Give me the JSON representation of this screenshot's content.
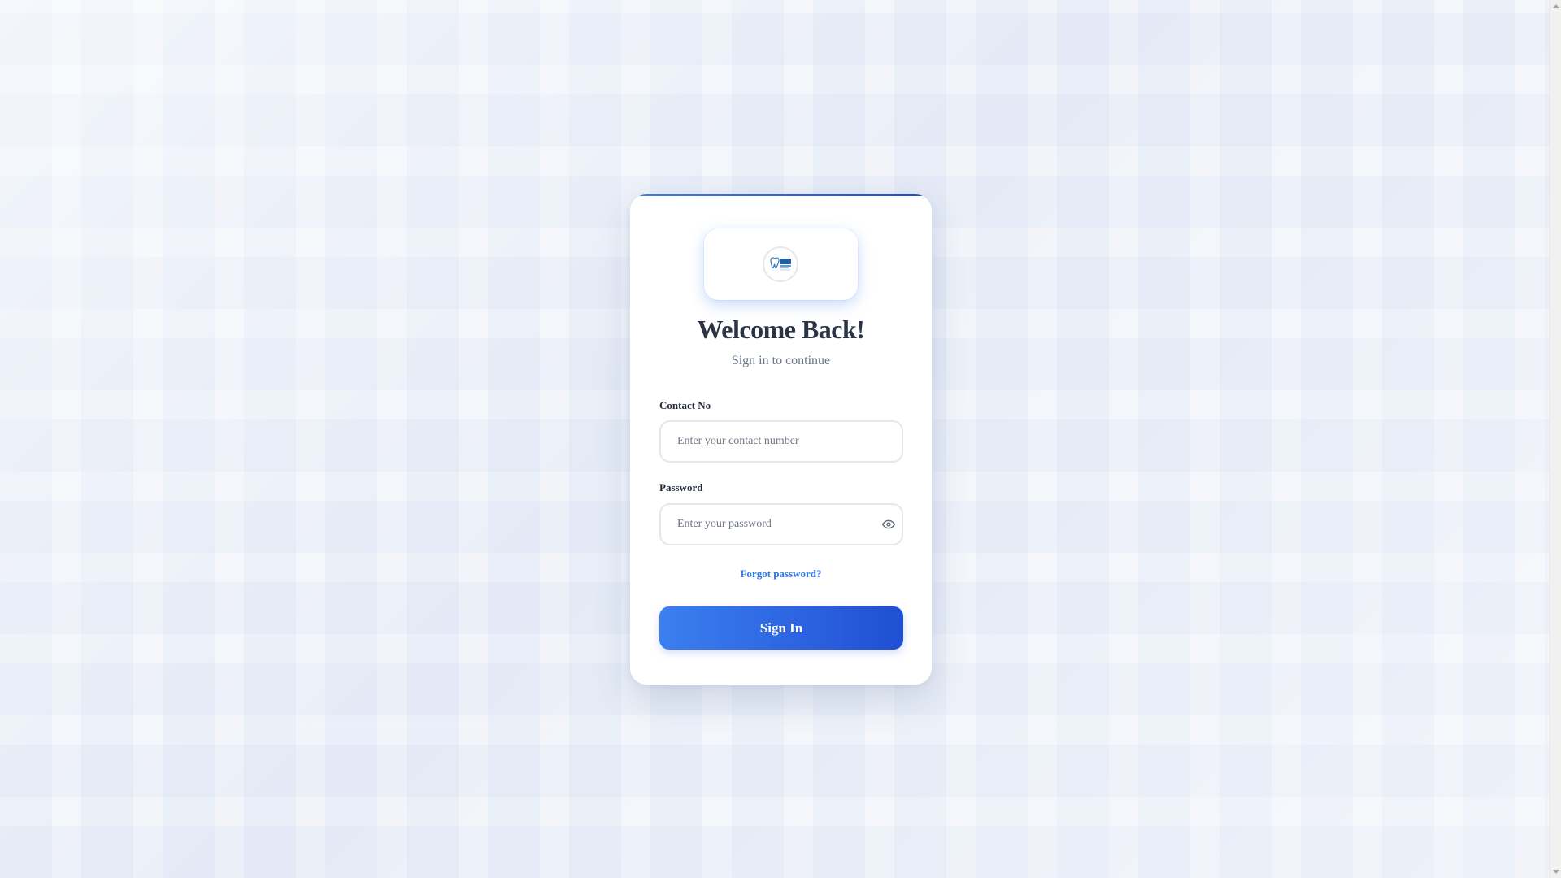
{
  "login": {
    "title": "Welcome Back!",
    "subtitle": "Sign in to continue",
    "contact": {
      "label": "Contact No",
      "placeholder": "Enter your contact number",
      "value": ""
    },
    "password": {
      "label": "Password",
      "placeholder": "Enter your password",
      "value": "",
      "toggle_icon": "eye-icon"
    },
    "forgot_label": "Forgot password?",
    "signin_label": "Sign In",
    "logo_icon": "clinic-logo-icon"
  },
  "colors": {
    "accent": "#2f77e6",
    "button_start": "#3b7ff0",
    "button_end": "#1f4fd2",
    "title": "#2b3445",
    "subtitle": "#6b7686"
  }
}
